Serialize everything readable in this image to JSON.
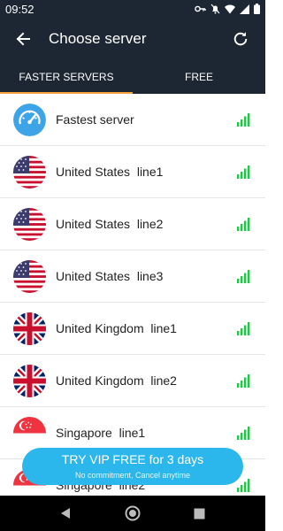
{
  "status_bar": {
    "time": "09:52",
    "icons": [
      "key-icon",
      "mute-icon",
      "wifi-icon",
      "signal-icon",
      "battery-icon"
    ]
  },
  "app_bar": {
    "title": "Choose server",
    "back_icon": "arrow-back-icon",
    "refresh_icon": "refresh-icon"
  },
  "tabs": [
    {
      "label": "FASTER SERVERS",
      "selected": true
    },
    {
      "label": "FREE",
      "selected": false
    }
  ],
  "servers": [
    {
      "name": "Fastest server",
      "icon": "speedometer-icon"
    },
    {
      "name": "United States  line1",
      "icon": "us-flag-icon"
    },
    {
      "name": "United States  line2",
      "icon": "us-flag-icon"
    },
    {
      "name": "United States  line3",
      "icon": "us-flag-icon"
    },
    {
      "name": "United Kingdom  line1",
      "icon": "uk-flag-icon"
    },
    {
      "name": "United Kingdom  line2",
      "icon": "uk-flag-icon"
    },
    {
      "name": "Singapore  line1",
      "icon": "sg-flag-icon"
    },
    {
      "name": "Singapore  line2",
      "icon": "sg-flag-icon"
    }
  ],
  "vip_banner": {
    "title": "TRY VIP FREE for 3 days",
    "subtitle": "No commitment, Cancel anytime"
  },
  "nav_bar": [
    "back-triangle-icon",
    "home-circle-icon",
    "recents-square-icon"
  ],
  "colors": {
    "header_bg": "#1d2633",
    "tab_indicator": "#f6a13a",
    "signal_green": "#27c24c",
    "vip_banner": "#2bb7eb"
  }
}
